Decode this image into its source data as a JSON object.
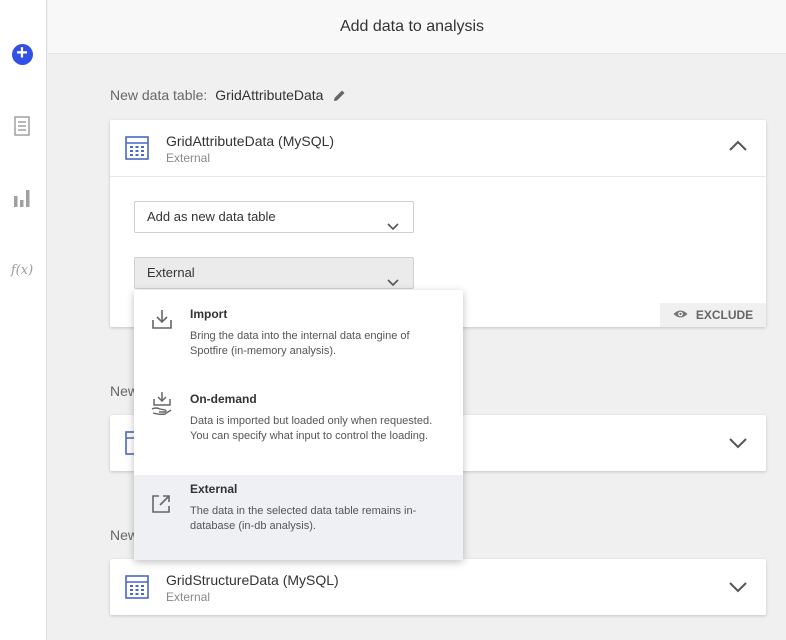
{
  "sidebar": {
    "items": [
      {
        "icon": "add-circle-icon",
        "color": "#3050e6"
      },
      {
        "icon": "data-table-icon"
      },
      {
        "icon": "bar-chart-icon"
      },
      {
        "icon": "function-icon",
        "glyph": "f(x)"
      }
    ]
  },
  "header": {
    "title": "Add data to analysis"
  },
  "section1": {
    "label": "New data table:",
    "table_name": "GridAttributeData",
    "card": {
      "title": "GridAttributeData (MySQL)",
      "subtitle": "External",
      "load_select": "Add as new data table",
      "method_select": "External",
      "exclude_label": "EXCLUDE"
    }
  },
  "section2": {
    "label": "New"
  },
  "section3": {
    "label": "New",
    "card": {
      "title": "GridStructureData (MySQL)",
      "subtitle": "External"
    }
  },
  "dropdown": {
    "options": [
      {
        "title": "Import",
        "description": "Bring the data into the internal data engine of Spotfire (in-memory analysis).",
        "icon": "import-icon"
      },
      {
        "title": "On-demand",
        "description": "Data is imported but loaded only when requested. You can specify what input to control the loading.",
        "icon": "on-demand-icon"
      },
      {
        "title": "External",
        "description": "The data in the selected data table remains in-database (in-db analysis).",
        "icon": "external-link-icon",
        "selected": true
      }
    ]
  },
  "colors": {
    "accent": "#3050e6",
    "table_icon": "#4a67c9"
  }
}
